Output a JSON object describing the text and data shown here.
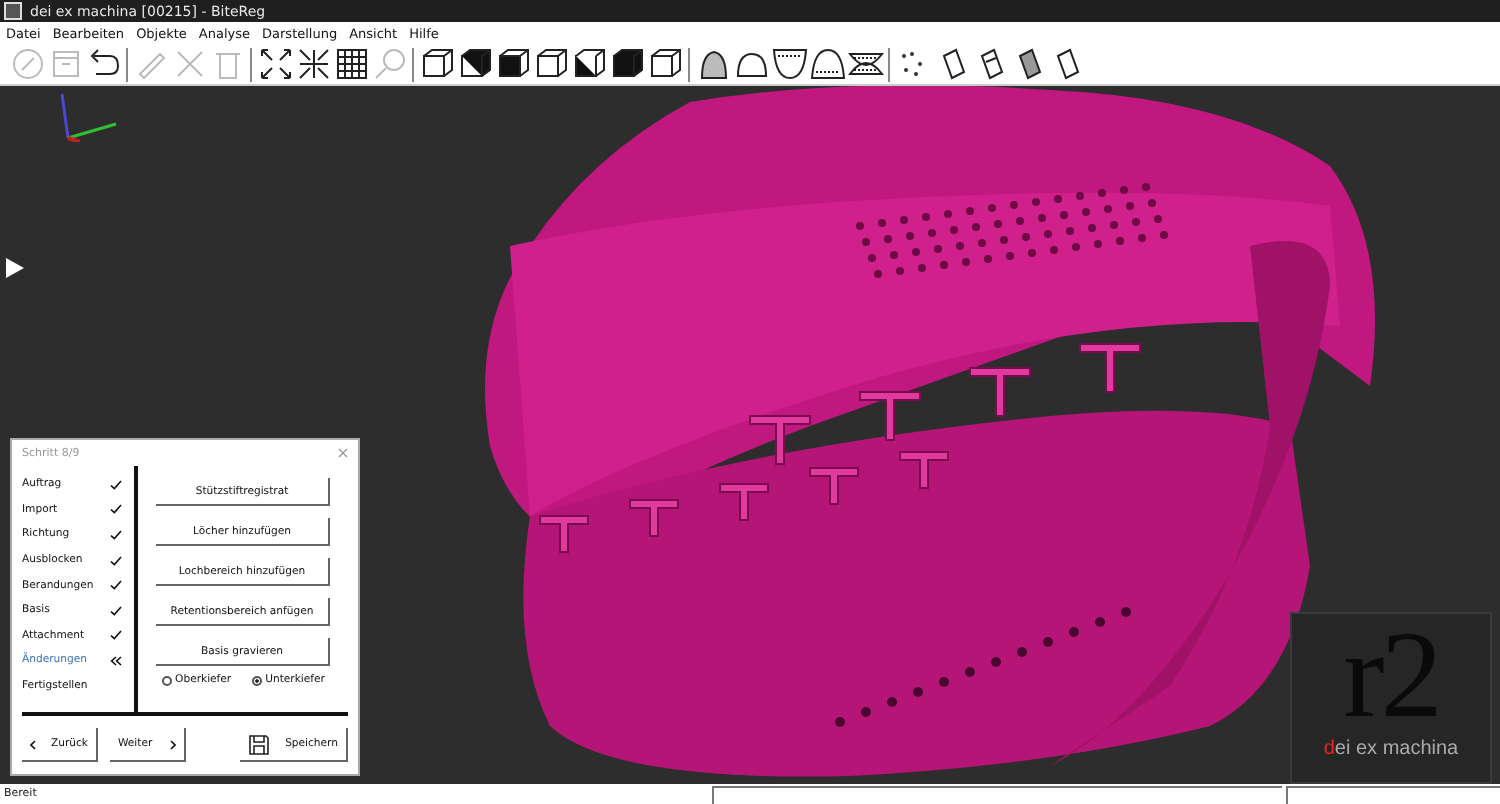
{
  "window": {
    "title": "dei ex machina [00215] - BiteReg"
  },
  "menu": [
    "Datei",
    "Bearbeiten",
    "Objekte",
    "Analyse",
    "Darstellung",
    "Ansicht",
    "Hilfe"
  ],
  "dialog": {
    "title": "Schritt 8/9",
    "steps": [
      {
        "label": "Auftrag",
        "kind": "done"
      },
      {
        "label": "Import",
        "kind": "done"
      },
      {
        "label": "Richtung",
        "kind": "done"
      },
      {
        "label": "Ausblocken",
        "kind": "done"
      },
      {
        "label": "Berandungen",
        "kind": "done"
      },
      {
        "label": "Basis",
        "kind": "done"
      },
      {
        "label": "Attachment",
        "kind": "done"
      },
      {
        "label": "Änderungen",
        "kind": "current"
      },
      {
        "label": "Fertigstellen",
        "kind": "pending"
      }
    ],
    "actions": [
      "Stützstiftregistrat",
      "Löcher hinzufügen",
      "Lochbereich hinzufügen",
      "Retentionsbereich anfügen",
      "Basis gravieren"
    ],
    "jaws": [
      {
        "label": "Oberkiefer",
        "selected": false
      },
      {
        "label": "Unterkiefer",
        "selected": true
      }
    ],
    "back": "Zurück",
    "next": "Weiter",
    "save": "Speichern"
  },
  "logo": {
    "mark": "r2",
    "subtitle": "dei ex machina"
  },
  "status_bar": {
    "text": "Bereit"
  }
}
